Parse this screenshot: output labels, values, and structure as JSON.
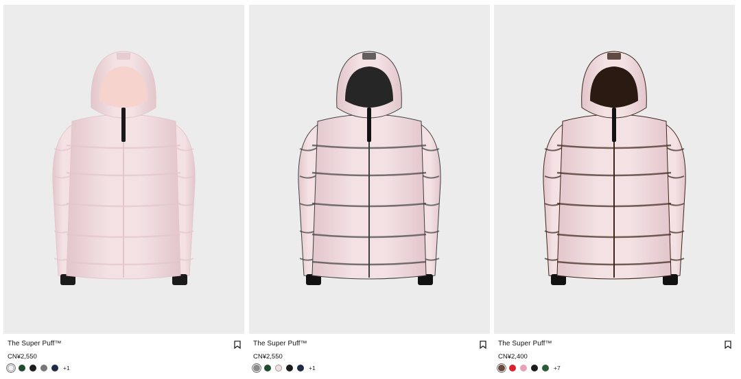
{
  "products": [
    {
      "name": "The Super Puff™",
      "price": "CN¥2,550",
      "colors": {
        "body": "#f3e1e4",
        "shade": "#e2c6cb",
        "hood_inner": "#f6d3cc",
        "accent": "#1a1a1a"
      },
      "swatches": [
        {
          "name": "white",
          "color": "#f1f1f1",
          "selected": true
        },
        {
          "name": "dark-green",
          "color": "#1f4a2d"
        },
        {
          "name": "black",
          "color": "#1b1b1b"
        },
        {
          "name": "grey",
          "color": "#777777"
        },
        {
          "name": "navy",
          "color": "#1f2a44"
        }
      ],
      "more": "+1"
    },
    {
      "name": "The Super Puff™",
      "price": "CN¥2,550",
      "colors": {
        "body": "#6a6a6a",
        "shade": "#3e3e3e",
        "hood_inner": "#262626",
        "accent": "#111111"
      },
      "swatches": [
        {
          "name": "grey",
          "color": "#8a8a8a",
          "selected": true
        },
        {
          "name": "dark-green",
          "color": "#1f4a2d"
        },
        {
          "name": "light-pink",
          "color": "#f2dfe2"
        },
        {
          "name": "black",
          "color": "#1b1b1b"
        },
        {
          "name": "navy",
          "color": "#1f2a44"
        }
      ],
      "more": "+1"
    },
    {
      "name": "The Super Puff™",
      "price": "CN¥2,400",
      "colors": {
        "body": "#5a3a2b",
        "shade": "#3b2418",
        "hood_inner": "#2a1a12",
        "accent": "#111111"
      },
      "swatches": [
        {
          "name": "brown",
          "color": "#6b4a3a",
          "selected": true
        },
        {
          "name": "red",
          "color": "#d8232f"
        },
        {
          "name": "pink",
          "color": "#e8a2b8"
        },
        {
          "name": "black",
          "color": "#1b1b1b"
        },
        {
          "name": "green",
          "color": "#2f5a38"
        }
      ],
      "more": "+7"
    }
  ]
}
